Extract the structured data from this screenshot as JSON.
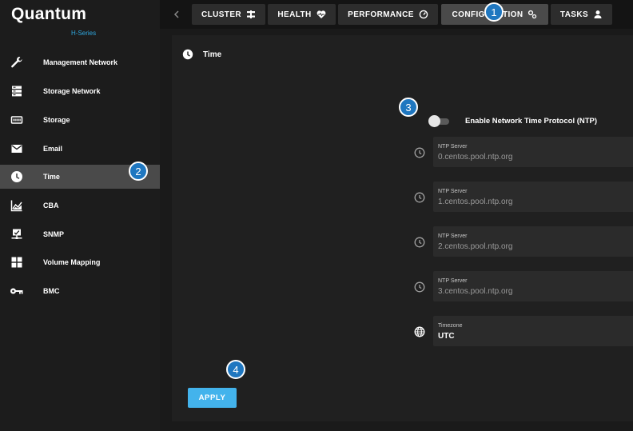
{
  "app": {
    "brand": "Quantum",
    "edition": "H-Series"
  },
  "topnav": {
    "tabs": [
      {
        "label": "CLUSTER",
        "icon": "cluster-icon"
      },
      {
        "label": "HEALTH",
        "icon": "heart-pulse-icon"
      },
      {
        "label": "PERFORMANCE",
        "icon": "gauge-icon"
      },
      {
        "label": "CONFIGURATION",
        "icon": "gears-icon",
        "active": true
      },
      {
        "label": "TASKS",
        "icon": "user-icon"
      }
    ]
  },
  "sidebar": {
    "items": [
      {
        "label": "Management Network",
        "icon": "wrench-icon"
      },
      {
        "label": "Storage Network",
        "icon": "server-icon"
      },
      {
        "label": "Storage",
        "icon": "drive-icon"
      },
      {
        "label": "Email",
        "icon": "envelope-icon"
      },
      {
        "label": "Time",
        "icon": "clock-icon",
        "active": true
      },
      {
        "label": "CBA",
        "icon": "chart-area-icon"
      },
      {
        "label": "SNMP",
        "icon": "monitor-network-icon"
      },
      {
        "label": "Volume Mapping",
        "icon": "grid-icon"
      },
      {
        "label": "BMC",
        "icon": "key-icon"
      }
    ]
  },
  "panel": {
    "title": "Time",
    "ntp_toggle": {
      "label": "Enable Network Time Protocol (NTP)",
      "enabled": false
    },
    "ntp_servers": [
      {
        "label": "NTP Server",
        "value": "0.centos.pool.ntp.org"
      },
      {
        "label": "NTP Server",
        "value": "1.centos.pool.ntp.org"
      },
      {
        "label": "NTP Server",
        "value": "2.centos.pool.ntp.org"
      },
      {
        "label": "NTP Server",
        "value": "3.centos.pool.ntp.org"
      }
    ],
    "timezone": {
      "label": "Timezone",
      "value": "UTC"
    },
    "apply_label": "APPLY"
  },
  "callouts": [
    "1",
    "2",
    "3",
    "4"
  ],
  "colors": {
    "accent": "#43b3ec",
    "callout": "#1f77c0",
    "active_bg": "#4a4a4a"
  }
}
